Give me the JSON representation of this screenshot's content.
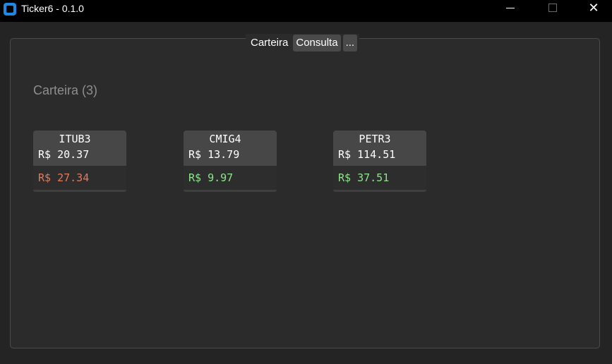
{
  "window": {
    "title": "Ticker6 - 0.1.0"
  },
  "tabs": [
    {
      "label": "Carteira"
    },
    {
      "label": "Consulta"
    },
    {
      "label": "..."
    }
  ],
  "section": {
    "title": "Carteira (3)"
  },
  "cards": [
    {
      "ticker": "ITUB3",
      "price": "R$ 20.37",
      "delta": "R$ 27.34",
      "delta_color": "#e27a5b"
    },
    {
      "ticker": "CMIG4",
      "price": "R$ 13.79",
      "delta": "R$ 9.97",
      "delta_color": "#8ee58e"
    },
    {
      "ticker": "PETR3",
      "price": "R$ 114.51",
      "delta": "R$ 37.51",
      "delta_color": "#8ee58e"
    }
  ],
  "colors": {
    "background": "#242424",
    "panel": "#2b2b2b",
    "titlebar": "#000000",
    "accent": "#1e88e5",
    "loss": "#e27a5b",
    "gain": "#8ee58e"
  },
  "icons": {
    "app": "app-icon",
    "minimize": "minimize-icon",
    "maximize": "maximize-icon",
    "close": "close-icon"
  }
}
